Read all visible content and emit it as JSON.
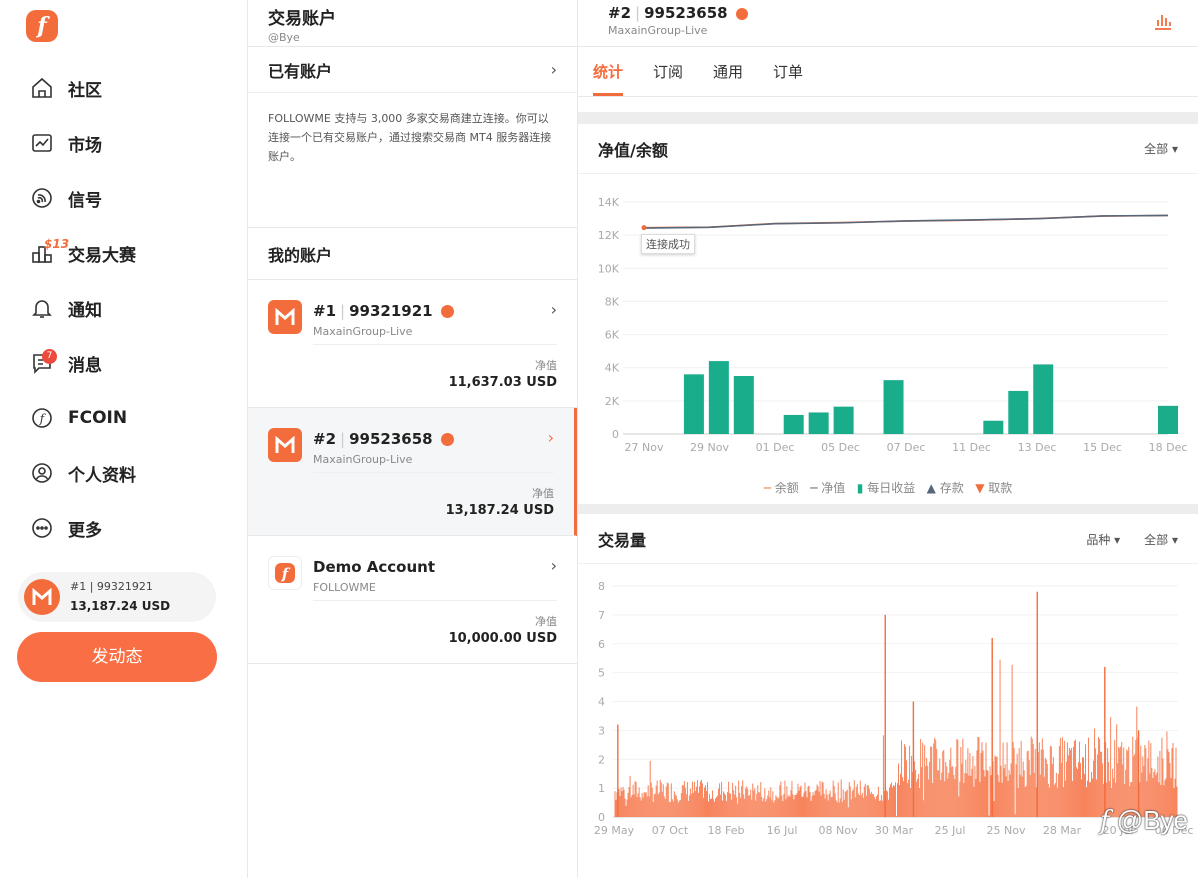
{
  "sidebar": {
    "logo": "f",
    "items": [
      {
        "label": "社区",
        "icon": "home-icon"
      },
      {
        "label": "市场",
        "icon": "market-chart-icon"
      },
      {
        "label": "信号",
        "icon": "signal-icon"
      },
      {
        "label": "交易大赛",
        "icon": "contest-icon",
        "tag": "$13"
      },
      {
        "label": "通知",
        "icon": "bell-icon"
      },
      {
        "label": "消息",
        "icon": "message-icon",
        "badge": "7"
      },
      {
        "label": "FCOIN",
        "icon": "fcoin-icon"
      },
      {
        "label": "个人资料",
        "icon": "user-icon"
      },
      {
        "label": "更多",
        "icon": "more-icon"
      }
    ],
    "account_pill": {
      "id": "#1 | 99321921",
      "amount": "13,187.24 USD"
    },
    "post_button": "发动态"
  },
  "accounts_panel": {
    "title": "交易账户",
    "subtitle": "@Bye",
    "existing_title": "已有账户",
    "description": "FOLLOWME 支持与 3,000 多家交易商建立连接。你可以连接一个已有交易账户，通过搜索交易商 MT4 服务器连接账户。",
    "my_accounts_title": "我的账户",
    "net_label": "净值",
    "cards": [
      {
        "num": "#1",
        "id": "99321921",
        "broker": "MaxainGroup-Live",
        "net_value": "11,637.03 USD",
        "active": false
      },
      {
        "num": "#2",
        "id": "99523658",
        "broker": "MaxainGroup-Live",
        "net_value": "13,187.24 USD",
        "active": true
      },
      {
        "num": "Demo Account",
        "id": "",
        "broker": "FOLLOWME",
        "net_value": "10,000.00 USD",
        "active": false
      }
    ]
  },
  "detail": {
    "account_num": "#2",
    "account_id": "99523658",
    "broker": "MaxainGroup-Live",
    "tabs": [
      "统计",
      "订阅",
      "通用",
      "订单"
    ],
    "active_tab": "统计",
    "equity_card": {
      "title": "净值/余额",
      "filter": "全部 ▾",
      "annotation": "连接成功",
      "legend": [
        "余额",
        "净值",
        "每日收益",
        "存款",
        "取款"
      ]
    },
    "volume_card": {
      "title": "交易量",
      "filter1": "品种 ▾",
      "filter2": "全部 ▾"
    },
    "watermark": "@Bye"
  },
  "chart_data": [
    {
      "type": "line",
      "y_ticks": [
        "0",
        "2K",
        "4K",
        "6K",
        "8K",
        "10K",
        "12K",
        "14K"
      ],
      "x_ticks": [
        "27 Nov",
        "29 Nov",
        "01 Dec",
        "05 Dec",
        "07 Dec",
        "11 Dec",
        "13 Dec",
        "15 Dec",
        "18 Dec"
      ],
      "ylim": [
        0,
        14000
      ],
      "series": [
        {
          "name": "余额",
          "values": [
            12450,
            12480,
            12700,
            12760,
            12850,
            12900,
            13000,
            13150,
            13187
          ]
        },
        {
          "name": "净值",
          "values": [
            12430,
            12470,
            12690,
            12740,
            12860,
            12920,
            12990,
            13160,
            13187
          ]
        }
      ],
      "bars": {
        "name": "每日收益",
        "categories": [
          "29 Nov",
          "30 Nov",
          "01 Dec",
          "03 Dec",
          "04 Dec",
          "05 Dec",
          "07 Dec",
          "11 Dec",
          "12 Dec",
          "13 Dec",
          "18 Dec"
        ],
        "values": [
          3600,
          4400,
          3500,
          1150,
          1300,
          1650,
          3250,
          800,
          2600,
          4200,
          1700
        ]
      }
    },
    {
      "type": "bar",
      "y_ticks": [
        "0",
        "1",
        "2",
        "3",
        "4",
        "5",
        "6",
        "7",
        "8"
      ],
      "x_ticks": [
        "29 May",
        "07 Oct",
        "18 Feb",
        "16 Jul",
        "08 Nov",
        "30 Mar",
        "25 Jul",
        "25 Nov",
        "28 Mar",
        "20 Jul",
        "06 Dec"
      ],
      "ylim": [
        0,
        8
      ],
      "peaks": [
        3.2,
        2.1,
        1.2,
        0.8,
        1.1,
        7.0,
        4.0,
        6.2,
        7.8,
        5.2,
        3.0
      ]
    }
  ]
}
